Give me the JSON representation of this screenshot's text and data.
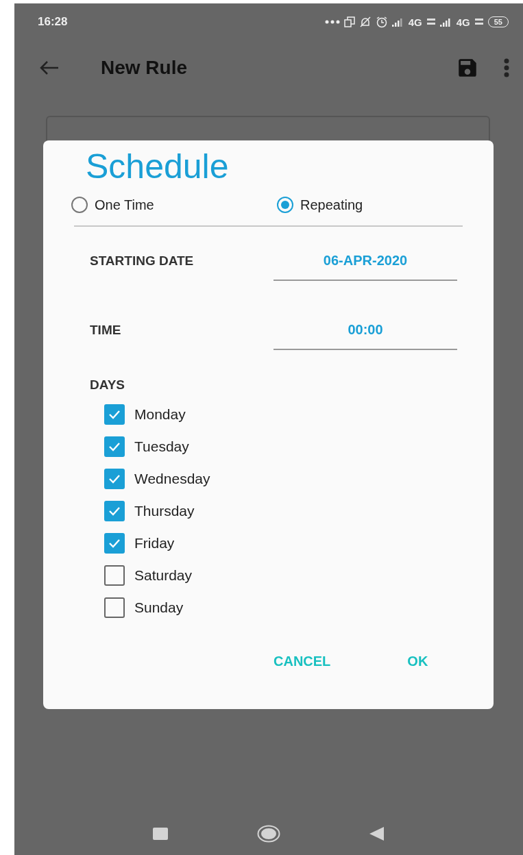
{
  "status_bar": {
    "time": "16:28",
    "network_1": "4G",
    "network_2": "4G",
    "battery": "55"
  },
  "app_bar": {
    "title": "New Rule"
  },
  "dialog": {
    "title": "Schedule",
    "schedule_types": [
      {
        "label": "One Time",
        "selected": false
      },
      {
        "label": "Repeating",
        "selected": true
      }
    ],
    "starting_date": {
      "label": "STARTING DATE",
      "value": "06-APR-2020"
    },
    "time": {
      "label": "TIME",
      "value": "00:00"
    },
    "days_label": "DAYS",
    "days": [
      {
        "label": "Monday",
        "checked": true
      },
      {
        "label": "Tuesday",
        "checked": true
      },
      {
        "label": "Wednesday",
        "checked": true
      },
      {
        "label": "Thursday",
        "checked": true
      },
      {
        "label": "Friday",
        "checked": true
      },
      {
        "label": "Saturday",
        "checked": false
      },
      {
        "label": "Sunday",
        "checked": false
      }
    ],
    "buttons": [
      "CANCEL",
      "OK"
    ]
  }
}
